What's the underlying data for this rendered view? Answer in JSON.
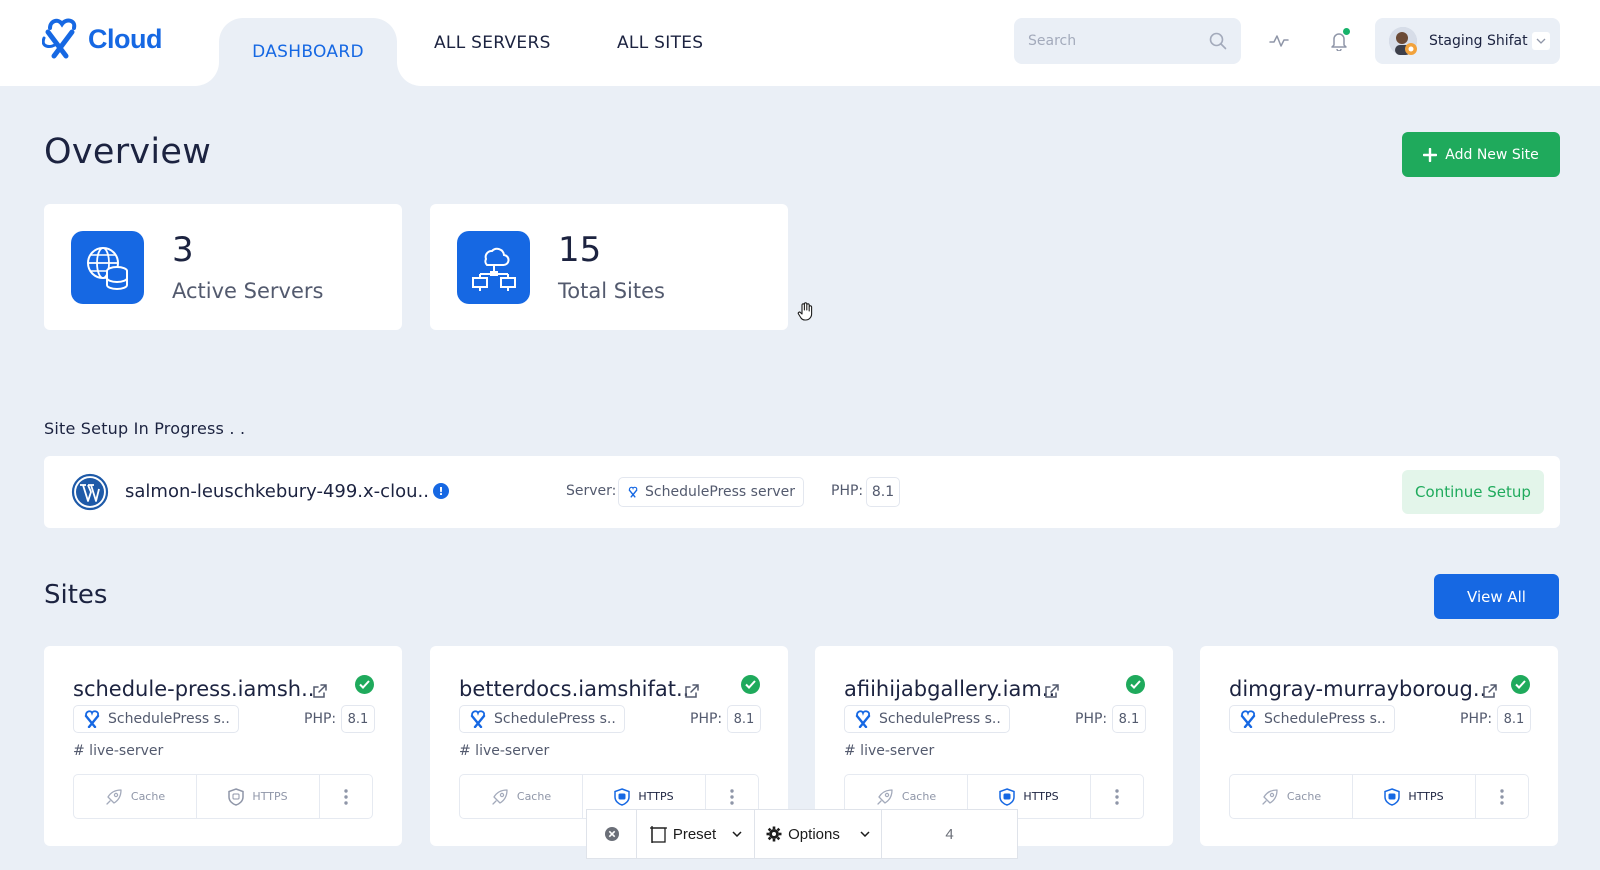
{
  "header": {
    "logo_text": "Cloud",
    "nav": [
      "DASHBOARD",
      "ALL SERVERS",
      "ALL SITES"
    ],
    "active_nav": "DASHBOARD",
    "search_placeholder": "Search",
    "user_name": "Staging Shifat"
  },
  "overview": {
    "title": "Overview",
    "add_button": "Add New Site",
    "stats": [
      {
        "value": "3",
        "label": "Active Servers",
        "icon": "globe-database-icon"
      },
      {
        "value": "15",
        "label": "Total Sites",
        "icon": "cloud-network-icon"
      }
    ]
  },
  "setup": {
    "section_label": "Site Setup In Progress . .",
    "site_name": "salmon-leuschkebury-499.x-clou..",
    "server_label": "Server:",
    "server_name": "SchedulePress server",
    "php_label": "PHP:",
    "php_version": "8.1",
    "continue_button": "Continue Setup"
  },
  "sites": {
    "title": "Sites",
    "view_all": "View All",
    "items": [
      {
        "name": "schedule-press.iamsh..",
        "server": "SchedulePress s..",
        "php_label": "PHP:",
        "php": "8.1",
        "tag": "# live-server",
        "cache": "Cache",
        "https": "HTTPS",
        "https_active": false
      },
      {
        "name": "betterdocs.iamshifat..",
        "server": "SchedulePress s..",
        "php_label": "PHP:",
        "php": "8.1",
        "tag": "# live-server",
        "cache": "Cache",
        "https": "HTTPS",
        "https_active": true
      },
      {
        "name": "afiihijabgallery.iam..",
        "server": "SchedulePress s..",
        "php_label": "PHP:",
        "php": "8.1",
        "tag": "# live-server",
        "cache": "Cache",
        "https": "HTTPS",
        "https_active": true
      },
      {
        "name": "dimgray-murrayboroug..",
        "server": "SchedulePress s..",
        "php_label": "PHP:",
        "php": "8.1",
        "tag": "",
        "cache": "Cache",
        "https": "HTTPS",
        "https_active": true
      }
    ]
  },
  "toolbar": {
    "preset": "Preset",
    "options": "Options",
    "value": "4"
  },
  "colors": {
    "brand_blue": "#1668e3",
    "green": "#1faa5c",
    "background": "#eaeff6"
  }
}
